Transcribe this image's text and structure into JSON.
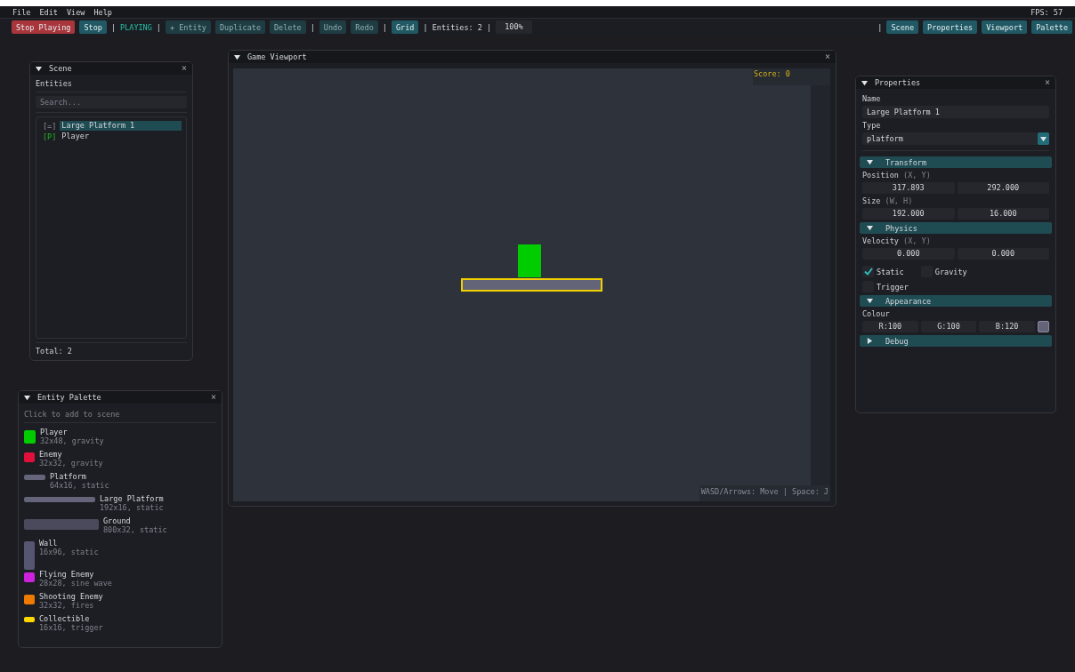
{
  "menu": {
    "items": [
      "File",
      "Edit",
      "View",
      "Help"
    ],
    "fps": "FPS: 57"
  },
  "toolbar": {
    "left": [
      {
        "kind": "danger",
        "label": "Stop Playing",
        "disabled": false
      },
      {
        "kind": "button",
        "label": "Stop",
        "disabled": false
      },
      {
        "kind": "separator",
        "label": "|"
      },
      {
        "kind": "status",
        "label": "PLAYING"
      },
      {
        "kind": "separator",
        "label": "|"
      },
      {
        "kind": "button",
        "label": "+ Entity",
        "disabled": true
      },
      {
        "kind": "button",
        "label": "Duplicate",
        "disabled": true
      },
      {
        "kind": "button",
        "label": "Delete",
        "disabled": true
      },
      {
        "kind": "separator",
        "label": "|"
      },
      {
        "kind": "button",
        "label": "Undo",
        "disabled": true
      },
      {
        "kind": "button",
        "label": "Redo",
        "disabled": true
      },
      {
        "kind": "separator",
        "label": "|"
      },
      {
        "kind": "button",
        "label": "Grid",
        "disabled": false
      },
      {
        "kind": "text",
        "label": "| Entities: 2 |"
      },
      {
        "kind": "field",
        "label": "100%"
      }
    ],
    "right": [
      {
        "kind": "separator",
        "label": "|"
      },
      {
        "kind": "button",
        "label": "Scene",
        "disabled": false
      },
      {
        "kind": "button",
        "label": "Properties",
        "disabled": false
      },
      {
        "kind": "button",
        "label": "Viewport",
        "disabled": false
      },
      {
        "kind": "button",
        "label": "Palette",
        "disabled": false
      }
    ]
  },
  "scene": {
    "title": "Scene",
    "expanded": true,
    "close": "×",
    "heading": "Entities",
    "search_placeholder": "Search...",
    "entities": [
      {
        "kind": "platform",
        "tag": "[=]",
        "name": "Large Platform 1",
        "selected": true
      },
      {
        "kind": "player",
        "tag": "[P]",
        "name": "Player",
        "selected": false
      }
    ],
    "total": "Total: 2"
  },
  "palette": {
    "title": "Entity Palette",
    "expanded": true,
    "close": "×",
    "hint": "Click to add to scene",
    "items": [
      {
        "kind": "square",
        "color": "#00cc00",
        "name": "Player",
        "detail": "32x48, gravity"
      },
      {
        "kind": "small",
        "color": "#e0103a",
        "name": "Enemy",
        "detail": "32x32, gravity"
      },
      {
        "kind": "bar",
        "color": "#64647a",
        "name": "Platform",
        "detail": "64x16, static"
      },
      {
        "kind": "long-bar",
        "color": "#64647a",
        "name": "Large Platform",
        "detail": "192x16, static"
      },
      {
        "kind": "ground",
        "color": "#4a4a5c",
        "name": "Ground",
        "detail": "800x32, static"
      },
      {
        "kind": "wall",
        "color": "#565670",
        "name": "Wall",
        "detail": "16x96, static"
      },
      {
        "kind": "small",
        "color": "#cc22dd",
        "name": "Flying Enemy",
        "detail": "28x28, sine wave"
      },
      {
        "kind": "small",
        "color": "#ee7a00",
        "name": "Shooting Enemy",
        "detail": "32x32, fires"
      },
      {
        "kind": "flat",
        "color": "#ffd800",
        "name": "Collectible",
        "detail": "16x16, trigger"
      }
    ]
  },
  "viewport": {
    "title": "Game Viewport",
    "expanded": true,
    "close": "×",
    "score": "Score: 0",
    "help": "WASD/Arrows: Move | Space: J",
    "entities": [
      {
        "kind": "player",
        "color": "#00cc00",
        "selected": false
      },
      {
        "kind": "platform",
        "color": "#646478",
        "selected": true
      }
    ]
  },
  "properties": {
    "title": "Properties",
    "expanded": true,
    "close": "×",
    "name_label": "Name",
    "name": "Large Platform 1",
    "type_label": "Type",
    "type": "platform",
    "sections": [
      {
        "kind": "pairs",
        "title": "Transform",
        "expanded": true,
        "rows": [
          {
            "label": "Position",
            "hint": "(X, Y)",
            "values": [
              "317.893",
              "292.000"
            ]
          },
          {
            "label": "Size",
            "hint": "(W, H)",
            "values": [
              "192.000",
              "16.000"
            ]
          }
        ]
      },
      {
        "kind": "pairs",
        "title": "Physics",
        "expanded": true,
        "rows": [
          {
            "label": "Velocity",
            "hint": "(X, Y)",
            "values": [
              "0.000",
              "0.000"
            ]
          }
        ],
        "checks": [
          {
            "label": "Static",
            "checked": true
          },
          {
            "label": "Gravity",
            "checked": false
          },
          {
            "label": "Trigger",
            "checked": false
          }
        ]
      },
      {
        "kind": "colour",
        "title": "Appearance",
        "expanded": true,
        "label": "Colour",
        "values": [
          "R:100",
          "G:100",
          "B:120"
        ],
        "color": "#646478"
      },
      {
        "title": "Debug",
        "expanded": false
      }
    ]
  }
}
